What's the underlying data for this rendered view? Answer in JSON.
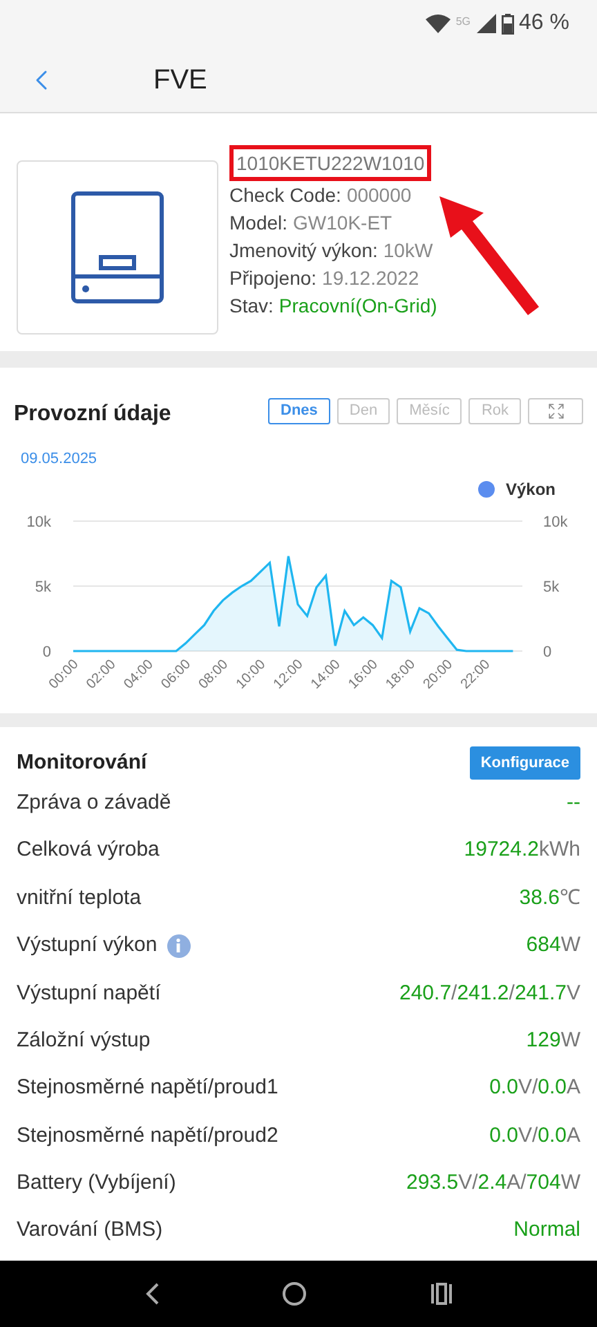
{
  "status_bar": {
    "network": "5G",
    "battery": "46 %"
  },
  "header": {
    "title": "FVE"
  },
  "device": {
    "serial": "1010KETU222W1010",
    "fields": [
      {
        "label": "Check Code:",
        "value": "000000",
        "kind": "plain"
      },
      {
        "label": "Model:",
        "value": "GW10K-ET",
        "kind": "plain"
      },
      {
        "label": "Jmenovitý výkon:",
        "value": "10kW",
        "kind": "plain"
      },
      {
        "label": "Připojeno:",
        "value": "19.12.2022",
        "kind": "plain"
      },
      {
        "label": "Stav:",
        "value": "Pracovní(On-Grid)",
        "kind": "status"
      }
    ]
  },
  "operation": {
    "title": "Provozní údaje",
    "tabs": [
      {
        "label": "Dnes",
        "selected": true
      },
      {
        "label": "Den",
        "selected": false
      },
      {
        "label": "Měsíc",
        "selected": false
      },
      {
        "label": "Rok",
        "selected": false
      }
    ],
    "date": "09.05.2025",
    "chart_data": {
      "type": "line",
      "x": [
        0,
        0.5,
        1,
        1.5,
        2,
        2.5,
        3,
        3.5,
        4,
        4.5,
        5,
        5.5,
        6,
        6.5,
        7,
        7.5,
        8,
        8.5,
        9,
        9.5,
        10,
        10.5,
        11,
        11.5,
        12,
        12.5,
        13,
        13.5,
        14,
        14.5,
        15,
        15.5,
        16,
        16.5,
        17,
        17.5,
        18,
        18.5,
        19,
        19.5,
        20,
        20.5,
        21,
        21.5,
        22,
        22.5,
        23,
        23.5
      ],
      "xlim": [
        0,
        24
      ],
      "series": [
        {
          "name": "Výkon",
          "color": "#1fb6f0",
          "values": [
            0,
            0,
            0,
            0,
            0,
            0,
            0,
            0,
            0,
            0,
            0,
            0,
            600,
            1300,
            2000,
            3100,
            3900,
            4500,
            5000,
            5400,
            6100,
            6800,
            1900,
            7300,
            3600,
            2700,
            4900,
            5800,
            400,
            3100,
            2000,
            2600,
            2000,
            1000,
            5400,
            4900,
            1500,
            3300,
            2900,
            1900,
            1000,
            100,
            0,
            0,
            0,
            0,
            0,
            0
          ]
        }
      ],
      "ylim": [
        0,
        10000
      ],
      "yticks": [
        {
          "value": 0,
          "label": "0"
        },
        {
          "value": 5000,
          "label": "5k"
        },
        {
          "value": 10000,
          "label": "10k"
        }
      ],
      "xticks": [
        {
          "value": 0,
          "label": "00:00"
        },
        {
          "value": 2,
          "label": "02:00"
        },
        {
          "value": 4,
          "label": "04:00"
        },
        {
          "value": 6,
          "label": "06:00"
        },
        {
          "value": 8,
          "label": "08:00"
        },
        {
          "value": 10,
          "label": "10:00"
        },
        {
          "value": 12,
          "label": "12:00"
        },
        {
          "value": 14,
          "label": "14:00"
        },
        {
          "value": 16,
          "label": "16:00"
        },
        {
          "value": 18,
          "label": "18:00"
        },
        {
          "value": 20,
          "label": "20:00"
        },
        {
          "value": 22,
          "label": "22:00"
        }
      ]
    }
  },
  "monitoring": {
    "title": "Monitorování",
    "button": "Konfigurace",
    "rows": [
      {
        "label": "Zpráva o závadě",
        "info_icon": false,
        "value": [
          {
            "text": "--",
            "kind": "number"
          }
        ]
      },
      {
        "label": "Celková výroba",
        "info_icon": false,
        "value": [
          {
            "text": "19724.2",
            "kind": "number"
          },
          {
            "text": "kWh",
            "kind": "unit"
          }
        ]
      },
      {
        "label": "vnitřní teplota",
        "info_icon": false,
        "value": [
          {
            "text": "38.6",
            "kind": "number"
          },
          {
            "text": "℃",
            "kind": "unit"
          }
        ]
      },
      {
        "label": "Výstupní výkon",
        "info_icon": true,
        "value": [
          {
            "text": "684",
            "kind": "number"
          },
          {
            "text": "W",
            "kind": "unit"
          }
        ]
      },
      {
        "label": "Výstupní napětí",
        "info_icon": false,
        "value": [
          {
            "text": "240.7",
            "kind": "number"
          },
          {
            "text": "/",
            "kind": "unit"
          },
          {
            "text": "241.2",
            "kind": "number"
          },
          {
            "text": "/",
            "kind": "unit"
          },
          {
            "text": "241.7",
            "kind": "number"
          },
          {
            "text": "V",
            "kind": "unit"
          }
        ]
      },
      {
        "label": "Záložní výstup",
        "info_icon": false,
        "value": [
          {
            "text": "129",
            "kind": "number"
          },
          {
            "text": "W",
            "kind": "unit"
          }
        ]
      },
      {
        "label": "Stejnosměrné napětí/proud1",
        "info_icon": false,
        "value": [
          {
            "text": "0.0",
            "kind": "number"
          },
          {
            "text": "V/",
            "kind": "unit"
          },
          {
            "text": "0.0",
            "kind": "number"
          },
          {
            "text": "A",
            "kind": "unit"
          }
        ]
      },
      {
        "label": "Stejnosměrné napětí/proud2",
        "info_icon": false,
        "value": [
          {
            "text": "0.0",
            "kind": "number"
          },
          {
            "text": "V/",
            "kind": "unit"
          },
          {
            "text": "0.0",
            "kind": "number"
          },
          {
            "text": "A",
            "kind": "unit"
          }
        ]
      },
      {
        "label": "Battery (Vybíjení)",
        "info_icon": false,
        "value": [
          {
            "text": "293.5",
            "kind": "number"
          },
          {
            "text": "V/",
            "kind": "unit"
          },
          {
            "text": "2.4",
            "kind": "number"
          },
          {
            "text": "A/",
            "kind": "unit"
          },
          {
            "text": "704",
            "kind": "number"
          },
          {
            "text": "W",
            "kind": "unit"
          }
        ]
      },
      {
        "label": "Varování (BMS)",
        "info_icon": false,
        "value": [
          {
            "text": "Normal",
            "kind": "number"
          }
        ]
      }
    ]
  }
}
